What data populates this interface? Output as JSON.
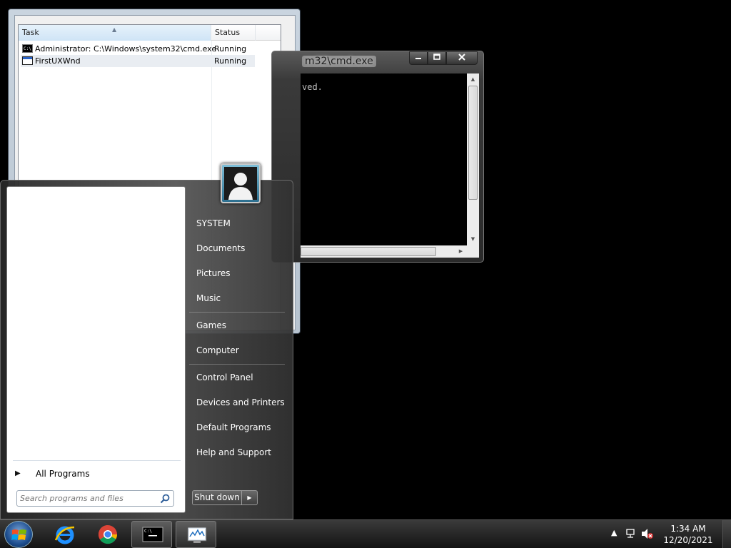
{
  "task_manager": {
    "columns": {
      "task": "Task",
      "status": "Status"
    },
    "rows": [
      {
        "task": "Administrator: C:\\Windows\\system32\\cmd.exe",
        "status": "Running",
        "icon": "cmd-icon"
      },
      {
        "task": "FirstUXWnd",
        "status": "Running",
        "icon": "window-icon"
      }
    ]
  },
  "cmd_window": {
    "title_fragment": "m32\\cmd.exe",
    "text": "ved."
  },
  "start_menu": {
    "user_name": "SYSTEM",
    "items": {
      "documents": "Documents",
      "pictures": "Pictures",
      "music": "Music",
      "games": "Games",
      "computer": "Computer",
      "control_panel": "Control Panel",
      "devices_printers": "Devices and Printers",
      "default_programs": "Default Programs",
      "help_support": "Help and Support"
    },
    "all_programs": "All Programs",
    "search_placeholder": "Search programs and files",
    "shutdown_label": "Shut down"
  },
  "taskbar": {
    "time": "1:34 AM",
    "date": "12/20/2021"
  },
  "colors": {
    "desktop": "#000000",
    "taskbar": "#2a2a2a"
  }
}
